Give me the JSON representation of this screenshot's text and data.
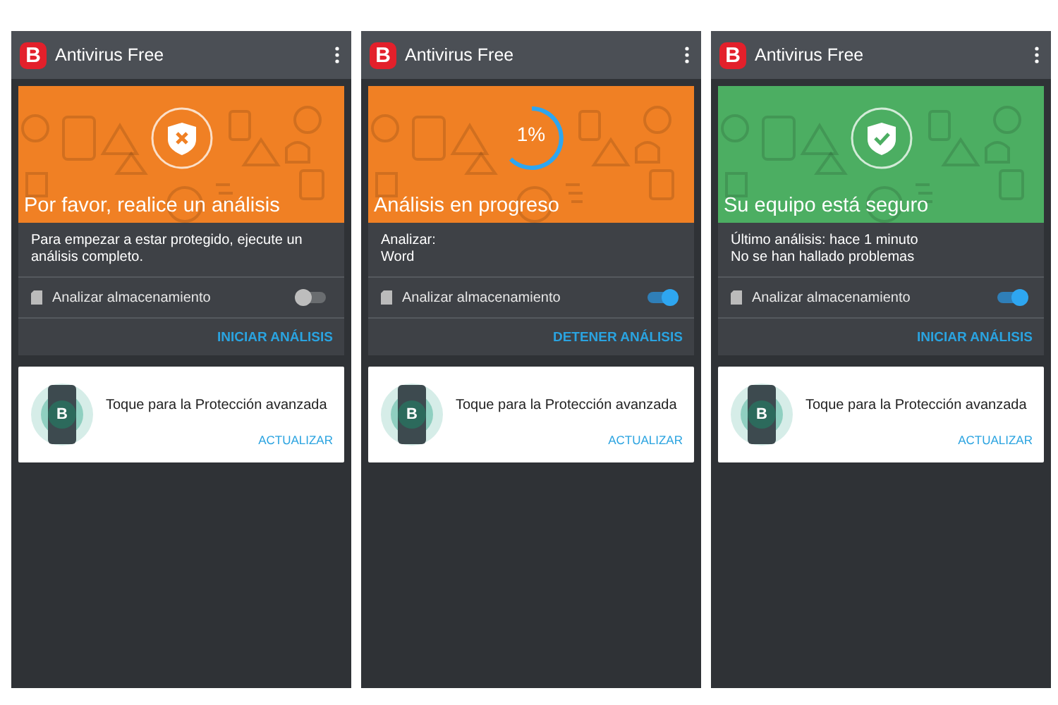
{
  "screens": [
    {
      "logo_letter": "B",
      "app_title": "Antivirus Free",
      "status": {
        "kind": "warning",
        "headline": "Por favor, realice un análisis"
      },
      "details": [
        "Para empezar a estar protegido, ejecute un análisis completo."
      ],
      "storage_toggle": {
        "label": "Analizar almacenamiento",
        "on": false
      },
      "action": "INICIAR ANÁLISIS",
      "promo": {
        "badge": "B",
        "text": "Toque para la Protección avanzada",
        "action": "ACTUALIZAR"
      }
    },
    {
      "logo_letter": "B",
      "app_title": "Antivirus Free",
      "status": {
        "kind": "progress",
        "percent": "1%",
        "headline": "Análisis en progreso"
      },
      "details": [
        "Analizar:",
        "Word"
      ],
      "storage_toggle": {
        "label": "Analizar almacenamiento",
        "on": true
      },
      "action": "DETENER ANÁLISIS",
      "promo": {
        "badge": "B",
        "text": "Toque para la Protección avanzada",
        "action": "ACTUALIZAR"
      }
    },
    {
      "logo_letter": "B",
      "app_title": "Antivirus Free",
      "status": {
        "kind": "safe",
        "headline": "Su equipo está seguro"
      },
      "details": [
        "Último análisis: hace 1 minuto",
        "No se han hallado problemas"
      ],
      "storage_toggle": {
        "label": "Analizar almacenamiento",
        "on": true
      },
      "action": "INICIAR ANÁLISIS",
      "promo": {
        "badge": "B",
        "text": "Toque para la Protección avanzada",
        "action": "ACTUALIZAR"
      }
    }
  ]
}
